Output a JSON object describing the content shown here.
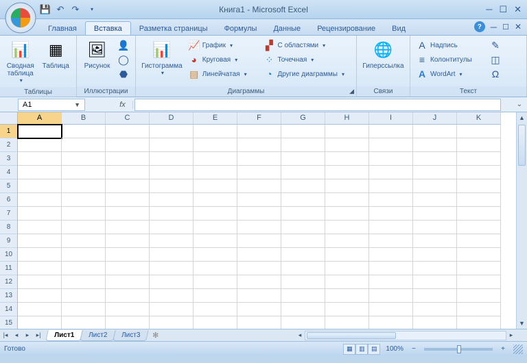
{
  "title": "Книга1 - Microsoft Excel",
  "qat": {
    "save": "💾",
    "undo": "↶",
    "redo": "↷"
  },
  "tabs": [
    "Главная",
    "Вставка",
    "Разметка страницы",
    "Формулы",
    "Данные",
    "Рецензирование",
    "Вид"
  ],
  "active_tab": 1,
  "ribbon": {
    "tables": {
      "label": "Таблицы",
      "pivot": "Сводная\nтаблица",
      "table": "Таблица"
    },
    "illustrations": {
      "label": "Иллюстрации",
      "picture": "Рисунок"
    },
    "charts": {
      "label": "Диаграммы",
      "histogram": "Гистограмма",
      "line": "График",
      "pie": "Круговая",
      "bar": "Линейчатая",
      "area": "С областями",
      "scatter": "Точечная",
      "other": "Другие диаграммы"
    },
    "links": {
      "label": "Связи",
      "hyperlink": "Гиперссылка"
    },
    "text": {
      "label": "Текст",
      "textbox": "Надпись",
      "headerfooter": "Колонтитулы",
      "wordart": "WordArt"
    }
  },
  "name_box": "A1",
  "columns": [
    "A",
    "B",
    "C",
    "D",
    "E",
    "F",
    "G",
    "H",
    "I",
    "J",
    "K"
  ],
  "rows": [
    "1",
    "2",
    "3",
    "4",
    "5",
    "6",
    "7",
    "8",
    "9",
    "10",
    "11",
    "12",
    "13",
    "14",
    "15"
  ],
  "selected_cell": {
    "row": 0,
    "col": 0
  },
  "sheets": [
    "Лист1",
    "Лист2",
    "Лист3"
  ],
  "active_sheet": 0,
  "status": {
    "ready": "Готово",
    "zoom": "100%"
  }
}
